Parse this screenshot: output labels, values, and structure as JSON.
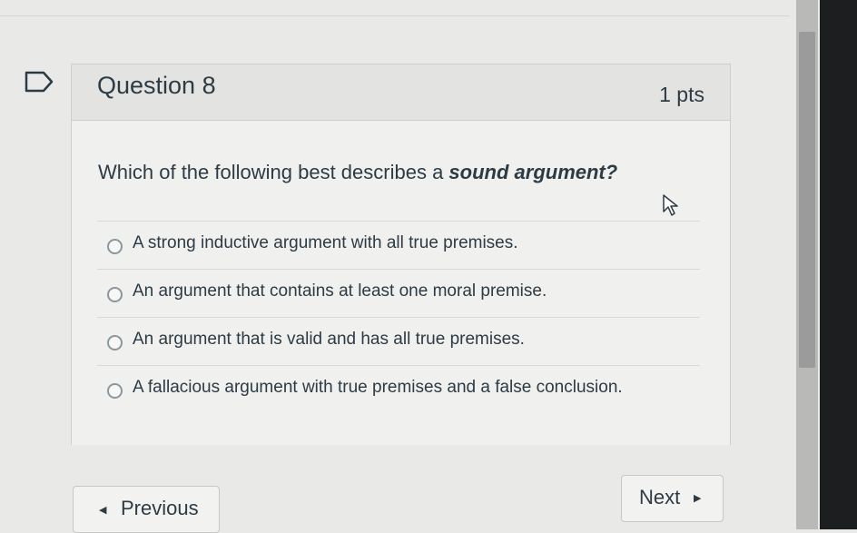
{
  "question": {
    "title": "Question 8",
    "points": "1 pts",
    "text_prefix": "Which of the following best describes a ",
    "text_emphasis": "sound argument?",
    "answers": [
      {
        "label": "A strong inductive argument with all true premises."
      },
      {
        "label": "An argument that contains at least one moral premise."
      },
      {
        "label": "An argument that is valid and has all true premises."
      },
      {
        "label": "A fallacious argument with true premises and a false conclusion."
      }
    ]
  },
  "nav": {
    "previous_label": "Previous",
    "next_label": "Next"
  },
  "icons": {
    "flag": "flag-outline-icon",
    "prev": "triangle-left-icon",
    "next": "triangle-right-icon",
    "cursor": "mouse-pointer-icon"
  }
}
